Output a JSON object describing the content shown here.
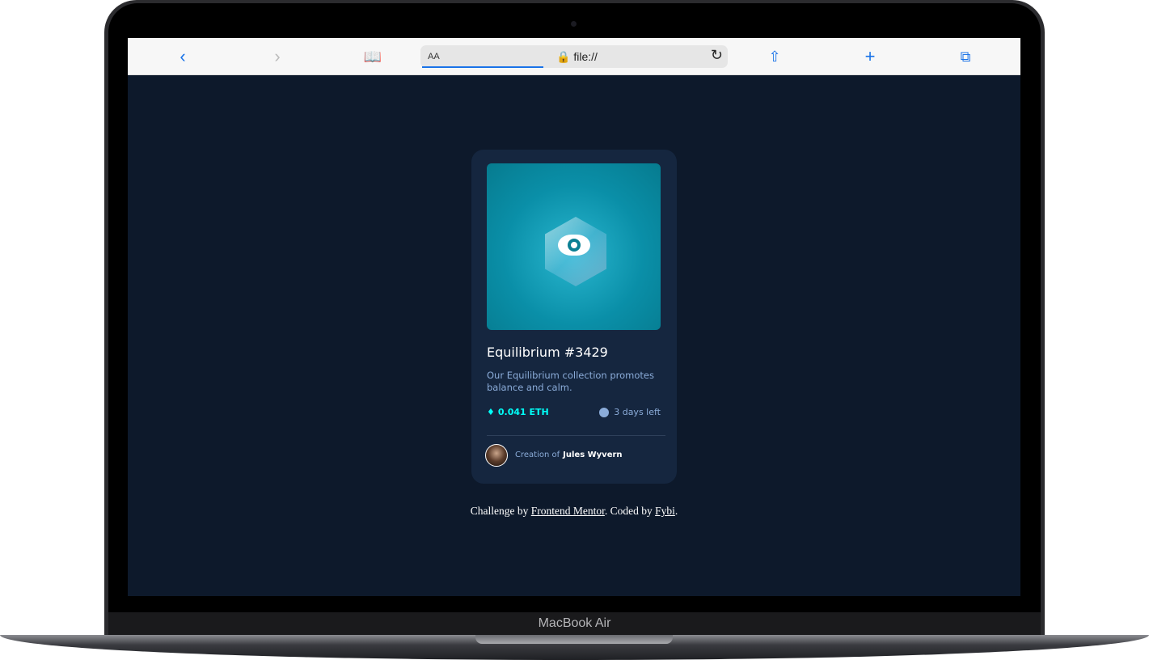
{
  "device": {
    "label": "MacBook Air"
  },
  "browser": {
    "text_size": "AA",
    "url": "file://"
  },
  "card": {
    "title": "Equilibrium #3429",
    "description": "Our Equilibrium collection promotes balance and calm.",
    "price": "0.041 ETH",
    "time_left": "3 days left",
    "creation_prefix": "Creation of",
    "creator": "Jules Wyvern"
  },
  "footer": {
    "prefix": "Challenge by",
    "link1": "Frontend Mentor",
    "middle": ". Coded by",
    "link2": "Fybi",
    "suffix": "."
  },
  "colors": {
    "background": "#0d192b",
    "card": "#15263f",
    "accent": "#00fff8",
    "muted": "#8bacd9"
  }
}
